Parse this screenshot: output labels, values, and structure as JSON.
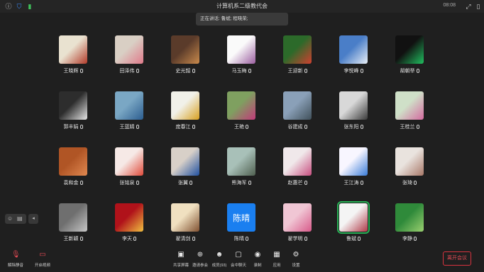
{
  "window": {
    "title": "计算机系二级教代会",
    "time": "08:08",
    "speaking_label": "正在讲话: 鲁斌; 程晓荣;"
  },
  "participants": [
    {
      "name": "王晓辉"
    },
    {
      "name": "田泽伟"
    },
    {
      "name": "史光韶"
    },
    {
      "name": "马玉梅"
    },
    {
      "name": "王迎新"
    },
    {
      "name": "李悦峰"
    },
    {
      "name": "胡朝举"
    },
    {
      "name": "郭丰娟"
    },
    {
      "name": "王蓝婧"
    },
    {
      "name": "庞春江"
    },
    {
      "name": "王艳"
    },
    {
      "name": "谷建成"
    },
    {
      "name": "张东阳"
    },
    {
      "name": "王桂兰"
    },
    {
      "name": "袁和金"
    },
    {
      "name": "张铭泉"
    },
    {
      "name": "张翼"
    },
    {
      "name": "熊海军"
    },
    {
      "name": "赵惠芒"
    },
    {
      "name": "王江涛"
    },
    {
      "name": "张琦"
    },
    {
      "name": "王新颖"
    },
    {
      "name": "李天"
    },
    {
      "name": "翟清剑"
    },
    {
      "name": "陈晴",
      "avatar_text": "陈晴"
    },
    {
      "name": "翟学明"
    },
    {
      "name": "鲁斌",
      "active": true
    },
    {
      "name": "李静"
    }
  ],
  "toolbar": {
    "left": [
      {
        "label": "解除静音",
        "icon": "muted-mic-icon"
      },
      {
        "label": "开启视频",
        "icon": "video-off-icon"
      }
    ],
    "center": [
      {
        "label": "共享屏幕",
        "icon": "share-screen-icon"
      },
      {
        "label": "邀请参会",
        "icon": "invite-icon"
      },
      {
        "label": "成员(93)",
        "icon": "members-icon"
      },
      {
        "label": "会中聊天",
        "icon": "chat-icon"
      },
      {
        "label": "录制",
        "icon": "record-icon"
      },
      {
        "label": "应用",
        "icon": "apps-icon"
      },
      {
        "label": "设置",
        "icon": "settings-icon"
      }
    ],
    "leave_label": "离开会议"
  },
  "colors": {
    "background": "#1f1f1f",
    "active_speaker": "#27b055",
    "leave": "#d9333f",
    "text_avatar": "#1a7ff0"
  }
}
